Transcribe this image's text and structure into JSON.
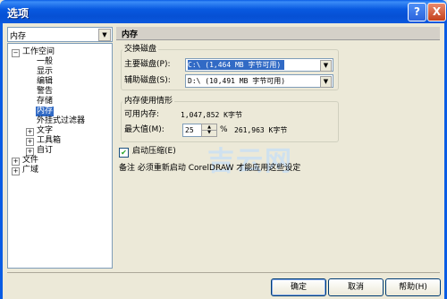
{
  "window": {
    "title": "选项",
    "help_glyph": "?",
    "close_glyph": "X"
  },
  "left": {
    "dropdown_value": "内存",
    "tree": [
      {
        "label": "工作空间",
        "expander": "−"
      },
      {
        "label": "一般"
      },
      {
        "label": "显示"
      },
      {
        "label": "编辑"
      },
      {
        "label": "警告"
      },
      {
        "label": "存储"
      },
      {
        "label": "内存",
        "selected": true
      },
      {
        "label": "外挂式过滤器"
      },
      {
        "label": "文字",
        "expander": "+"
      },
      {
        "label": "工具箱",
        "expander": "+"
      },
      {
        "label": "自订",
        "expander": "+"
      },
      {
        "label": "文件",
        "expander": "+"
      },
      {
        "label": "广域",
        "expander": "+"
      }
    ]
  },
  "right": {
    "section_title": "内存",
    "swap_group": {
      "label": "交换磁盘",
      "primary_label": "主要磁盘(P):",
      "primary_value": "C:\\  (1,464 MB 字节可用)",
      "secondary_label": "辅助磁盘(S):",
      "secondary_value": "D:\\  (10,491 MB 字节可用)"
    },
    "memory_group": {
      "label": "内存使用情形",
      "available_label": "可用内存:",
      "available_value": "1,047,852 K字节",
      "max_label": "最大值(M):",
      "max_value": "25",
      "percent_sign": "%",
      "max_bytes": "261,963 K字节"
    },
    "compress": {
      "label": "启动压缩(E)",
      "checked": true
    },
    "note": "备注   必须重新启动 CorelDRAW 才能应用这些设定",
    "watermark": "吉云网"
  },
  "buttons": {
    "ok": "确定",
    "cancel": "取消",
    "help": "帮助(H)"
  }
}
